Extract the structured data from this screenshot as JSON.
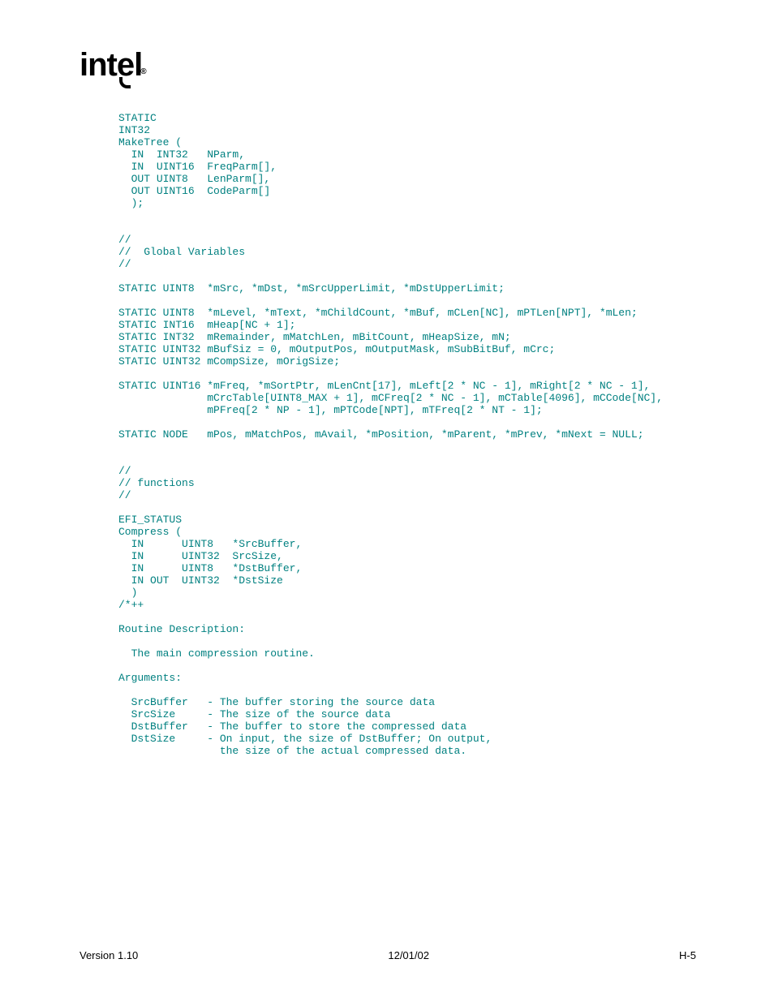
{
  "logo": "intel",
  "code": "STATIC\nINT32\nMakeTree (\n  IN  INT32   NParm,\n  IN  UINT16  FreqParm[],\n  OUT UINT8   LenParm[],\n  OUT UINT16  CodeParm[]\n  );\n\n\n//\n//  Global Variables\n//\n\nSTATIC UINT8  *mSrc, *mDst, *mSrcUpperLimit, *mDstUpperLimit;\n\nSTATIC UINT8  *mLevel, *mText, *mChildCount, *mBuf, mCLen[NC], mPTLen[NPT], *mLen;\nSTATIC INT16  mHeap[NC + 1];\nSTATIC INT32  mRemainder, mMatchLen, mBitCount, mHeapSize, mN;\nSTATIC UINT32 mBufSiz = 0, mOutputPos, mOutputMask, mSubBitBuf, mCrc;\nSTATIC UINT32 mCompSize, mOrigSize;\n\nSTATIC UINT16 *mFreq, *mSortPtr, mLenCnt[17], mLeft[2 * NC - 1], mRight[2 * NC - 1],\n              mCrcTable[UINT8_MAX + 1], mCFreq[2 * NC - 1], mCTable[4096], mCCode[NC],\n              mPFreq[2 * NP - 1], mPTCode[NPT], mTFreq[2 * NT - 1];\n\nSTATIC NODE   mPos, mMatchPos, mAvail, *mPosition, *mParent, *mPrev, *mNext = NULL;\n\n\n//\n// functions\n//\n\nEFI_STATUS\nCompress (\n  IN      UINT8   *SrcBuffer,\n  IN      UINT32  SrcSize,\n  IN      UINT8   *DstBuffer,\n  IN OUT  UINT32  *DstSize\n  )\n/*++\n\nRoutine Description:\n\n  The main compression routine.\n\nArguments:\n\n  SrcBuffer   - The buffer storing the source data\n  SrcSize     - The size of the source data\n  DstBuffer   - The buffer to store the compressed data\n  DstSize     - On input, the size of DstBuffer; On output,\n                the size of the actual compressed data.",
  "footer": {
    "left": "Version 1.10",
    "center": "12/01/02",
    "right": "H-5"
  }
}
